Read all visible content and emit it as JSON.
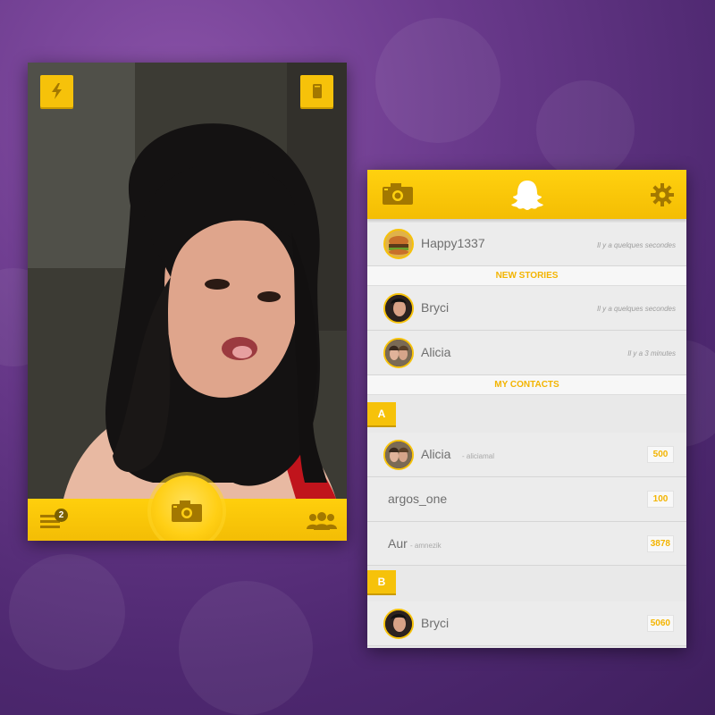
{
  "colors": {
    "accent": "#f6c20a",
    "background": "#5a2e7e",
    "list_bg": "#ececec"
  },
  "camera": {
    "flash_icon": "flash-icon",
    "flip_icon": "front-camera-icon",
    "capture_icon": "camera-icon",
    "stories_icon": "stories-list-icon",
    "stories_badge": "2",
    "friends_icon": "friends-icon"
  },
  "feed": {
    "header": {
      "left_icon": "camera-icon",
      "center_icon": "ghost-logo-icon",
      "right_icon": "gear-icon"
    },
    "top_item": {
      "name": "Happy1337",
      "time": "Il y a quelques secondes"
    },
    "sections": {
      "new_stories": "NEW STORIES",
      "my_contacts": "MY CONTACTS"
    },
    "stories": [
      {
        "name": "Bryci",
        "time": "Il y a quelques secondes"
      },
      {
        "name": "Alicia",
        "time": "Il y a 3 minutes"
      }
    ],
    "groups": [
      {
        "letter": "A",
        "contacts": [
          {
            "name": "Alicia",
            "username": "- aliciamal",
            "score": "500"
          },
          {
            "name": "argos_one",
            "username": "",
            "score": "100"
          },
          {
            "name": "Aur",
            "username": "- amnezik",
            "score": "3878"
          }
        ]
      },
      {
        "letter": "B",
        "contacts": [
          {
            "name": "Bryci",
            "username": "",
            "score": "5060"
          }
        ]
      }
    ]
  }
}
